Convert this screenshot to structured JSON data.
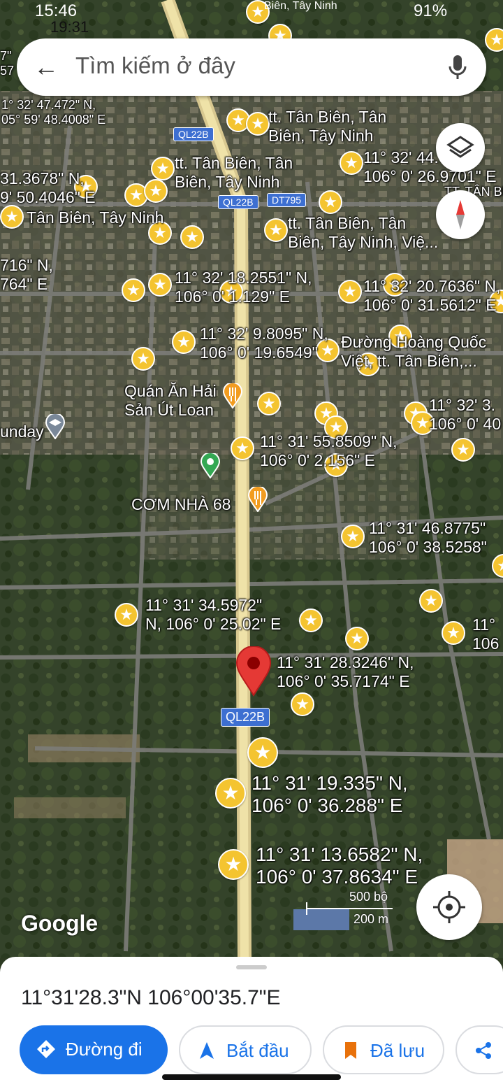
{
  "status": {
    "time": "15:46",
    "time_overlay": "19:31",
    "location_text": "Biên, Tây Ninh",
    "battery": "91%"
  },
  "search": {
    "placeholder": "Tìm kiếm ở đây"
  },
  "roads": {
    "ql22b": "QL22B",
    "dt795": "DT795"
  },
  "places": [
    {
      "text": "1° 32' 47.472\" N,\n05° 59' 48.4008\" E",
      "cls": "sm"
    },
    {
      "text": "tt. Tân Biên, Tân\nBiên, Tây Ninh",
      "cls": ""
    },
    {
      "text": "tt. Tân Biên, Tân\nBiên, Tây Ninh",
      "cls": ""
    },
    {
      "text": "11° 32' 44.7\n106° 0' 26.9701\" E",
      "cls": ""
    },
    {
      "text": "31.3678\" N,\n9' 50.4046\" E",
      "cls": ""
    },
    {
      "text": "Tân Biên, Tây Ninh",
      "cls": ""
    },
    {
      "text": "tt. Tân Biên, Tân\nBiên, Tây Ninh, Việ...",
      "cls": ""
    },
    {
      "text": "716\" N,\n764\" E",
      "cls": ""
    },
    {
      "text": "11° 32' 18.2551\" N,\n106° 0' 1.129\" E",
      "cls": ""
    },
    {
      "text": "11° 32' 20.7636\" N,\n106° 0' 31.5612\" E",
      "cls": ""
    },
    {
      "text": "11° 32' 9.8095\" N,\n106° 0' 19.6549\"",
      "cls": ""
    },
    {
      "text": "Đường Hoàng Quốc\nViệt, tt. Tân Biên,...",
      "cls": ""
    },
    {
      "text": "Quán Ăn Hải\nSản Út Loan",
      "cls": ""
    },
    {
      "text": "11° 32' 3.\n106° 0' 40",
      "cls": ""
    },
    {
      "text": "unday",
      "cls": ""
    },
    {
      "text": "11° 31' 55.8509\" N,\n106° 0' 2.156\" E",
      "cls": ""
    },
    {
      "text": "CƠM NHÀ 68",
      "cls": ""
    },
    {
      "text": "11° 31' 46.8775\"\n106° 0' 38.5258\"",
      "cls": ""
    },
    {
      "text": "11° 31' 34.5972\"\nN, 106° 0' 25.02\" E",
      "cls": ""
    },
    {
      "text": "11°\n106",
      "cls": ""
    },
    {
      "text": "11° 31' 28.3246\" N,\n106° 0' 35.7174\" E",
      "cls": ""
    },
    {
      "text": "11° 31' 19.335\" N,\n106° 0' 36.288\" E",
      "cls": "big"
    },
    {
      "text": "11° 31' 13.6582\" N,\n106° 0' 37.8634\" E",
      "cls": "big"
    },
    {
      "text": "TT. TÂN BI",
      "cls": "sm"
    },
    {
      "text": "7\"\n57",
      "cls": "sm"
    }
  ],
  "attribution": "Google",
  "scale": {
    "imperial": "500 bộ",
    "metric": "200 m"
  },
  "sheet": {
    "coordinates": "11°31'28.3\"N 106°00'35.7\"E",
    "directions_label": "Đường đi",
    "start_label": "Bắt đầu",
    "saved_label": "Đã lưu"
  }
}
